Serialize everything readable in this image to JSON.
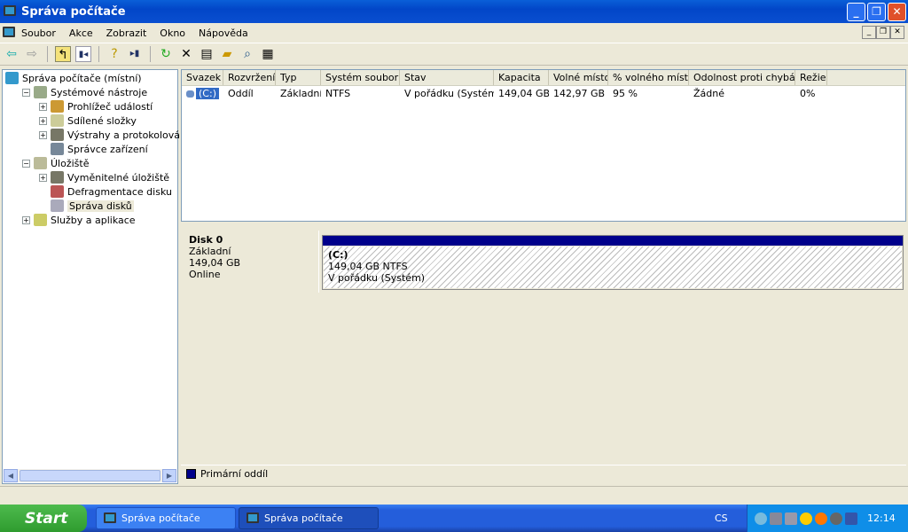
{
  "window": {
    "title": "Správa počítače",
    "minimize": "_",
    "maximize": "❐",
    "close": "✕"
  },
  "menu": [
    "Soubor",
    "Akce",
    "Zobrazit",
    "Okno",
    "Nápověda"
  ],
  "tree": [
    {
      "label": "Správa počítače (místní)",
      "level": 0,
      "expander": ""
    },
    {
      "label": "Systémové nástroje",
      "level": 1,
      "expander": "−"
    },
    {
      "label": "Prohlížeč událostí",
      "level": 2,
      "expander": "+"
    },
    {
      "label": "Sdílené složky",
      "level": 2,
      "expander": "+"
    },
    {
      "label": "Výstrahy a protokolování vý",
      "level": 2,
      "expander": "+"
    },
    {
      "label": "Správce zařízení",
      "level": 2,
      "expander": ""
    },
    {
      "label": "Úložiště",
      "level": 1,
      "expander": "−"
    },
    {
      "label": "Vyměnitelné úložiště",
      "level": 2,
      "expander": "+"
    },
    {
      "label": "Defragmentace disku",
      "level": 2,
      "expander": ""
    },
    {
      "label": "Správa disků",
      "level": 2,
      "expander": "",
      "selected": true
    },
    {
      "label": "Služby a aplikace",
      "level": 1,
      "expander": "+"
    }
  ],
  "volumes": {
    "columns": [
      "Svazek",
      "Rozvržení",
      "Typ",
      "Systém souborů",
      "Stav",
      "Kapacita",
      "Volné místo",
      "% volného místa",
      "Odolnost proti chybám",
      "Režie"
    ],
    "rows": [
      [
        "(C:)",
        "Oddíl",
        "Základní",
        "NTFS",
        "V pořádku (Systém)",
        "149,04 GB",
        "142,97 GB",
        "95 %",
        "Žádné",
        "0%"
      ]
    ]
  },
  "disk": {
    "name": "Disk 0",
    "type": "Základní",
    "size": "149,04 GB",
    "state": "Online",
    "partition": {
      "label": "(C:)",
      "size": "149,04 GB NTFS",
      "status": "V pořádku (Systém)",
      "color": "#00008b"
    }
  },
  "legend": {
    "label": "Primární oddíl",
    "color": "#00008b"
  },
  "taskbar": {
    "start": "Start",
    "tasks": [
      "Správa počítače",
      "Správa počítače"
    ],
    "lang": "CS",
    "clock": "12:14"
  }
}
